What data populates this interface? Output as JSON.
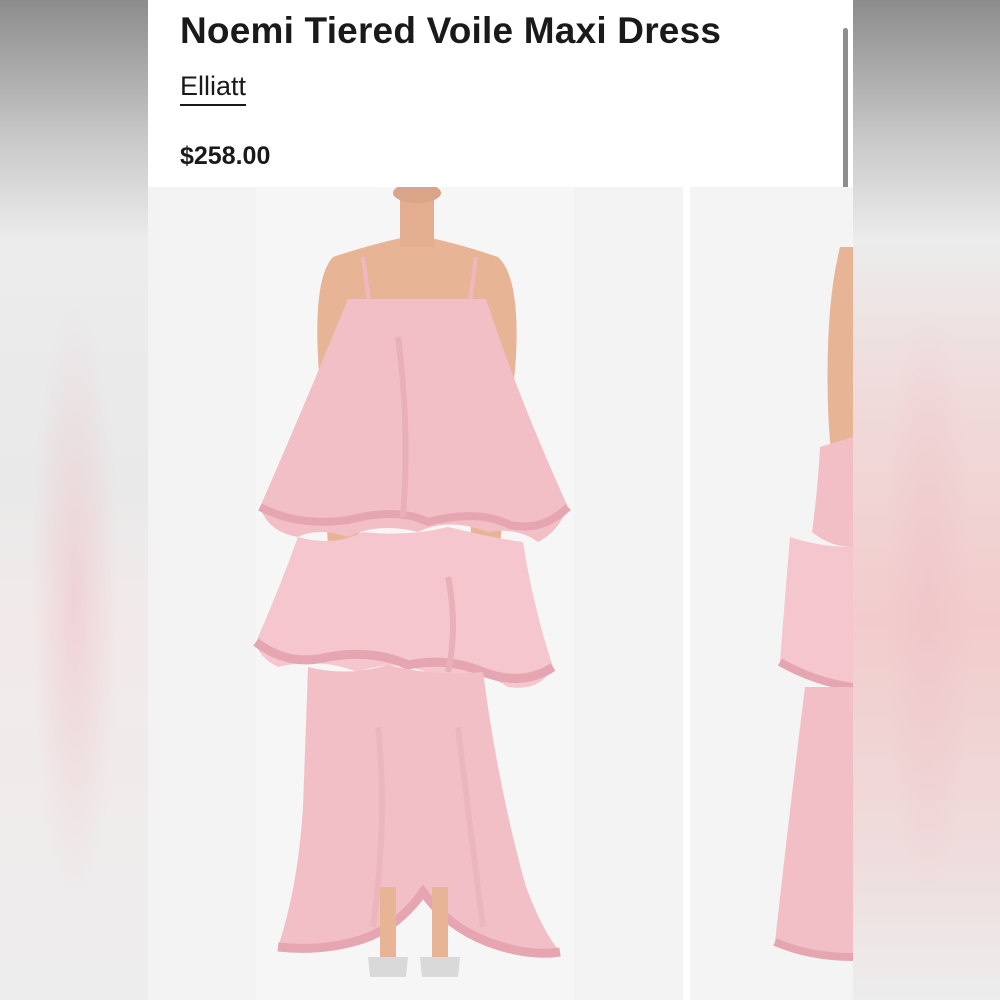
{
  "product": {
    "title": "Noemi Tiered Voile Maxi Dress",
    "brand": "Elliatt",
    "price": "$258.00"
  },
  "gallery": {
    "images": [
      {
        "subject": "model wearing pink tiered voile maxi dress, front view"
      },
      {
        "subject": "model wearing pink tiered voile maxi dress, side view (partially visible)"
      }
    ]
  },
  "colors": {
    "dress": "#f2bcc4",
    "dress_shadow": "#e4a2ad",
    "skin": "#e9b89a",
    "background": "#f3f3f3"
  }
}
